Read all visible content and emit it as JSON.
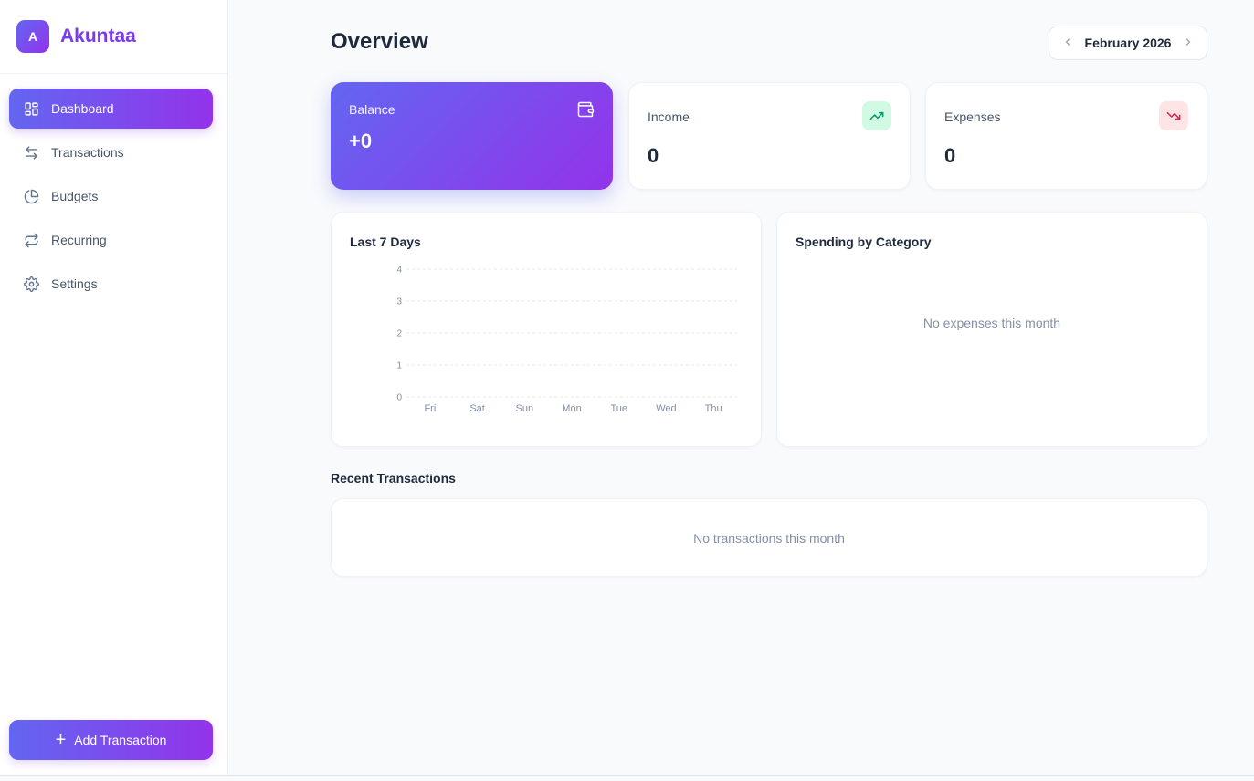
{
  "brand": {
    "logo_letter": "A",
    "name": "Akuntaa"
  },
  "nav": {
    "items": [
      {
        "label": "Dashboard",
        "icon": "grid-icon"
      },
      {
        "label": "Transactions",
        "icon": "arrows-left-right-icon"
      },
      {
        "label": "Budgets",
        "icon": "pie-chart-icon"
      },
      {
        "label": "Recurring",
        "icon": "repeat-icon"
      },
      {
        "label": "Settings",
        "icon": "gear-icon"
      }
    ]
  },
  "add_button": {
    "label": "Add Transaction",
    "icon": "plus-icon"
  },
  "header": {
    "title": "Overview",
    "month": "February 2026"
  },
  "summary": {
    "balance": {
      "label": "Balance",
      "value": "+0",
      "icon": "wallet-icon"
    },
    "income": {
      "label": "Income",
      "value": "0",
      "icon": "trending-up-icon"
    },
    "expenses": {
      "label": "Expenses",
      "value": "0",
      "icon": "trending-down-icon"
    }
  },
  "colors": {
    "accent_start": "#6366f1",
    "accent_end": "#9333ea",
    "income_bg": "#d1fae5",
    "income_fg": "#059669",
    "expense_bg": "#ffe4e6",
    "expense_fg": "#e11d48"
  },
  "last7": {
    "title": "Last 7 Days"
  },
  "chart_data": {
    "type": "bar",
    "title": "Last 7 Days",
    "categories": [
      "Fri",
      "Sat",
      "Sun",
      "Mon",
      "Tue",
      "Wed",
      "Thu"
    ],
    "values": [
      0,
      0,
      0,
      0,
      0,
      0,
      0
    ],
    "y_ticks": [
      "4",
      "3",
      "2",
      "1",
      "0"
    ],
    "ylim": [
      0,
      4
    ],
    "grid": true
  },
  "spending": {
    "title": "Spending by Category",
    "empty": "No expenses this month"
  },
  "recent": {
    "title": "Recent Transactions",
    "empty": "No transactions this month"
  }
}
